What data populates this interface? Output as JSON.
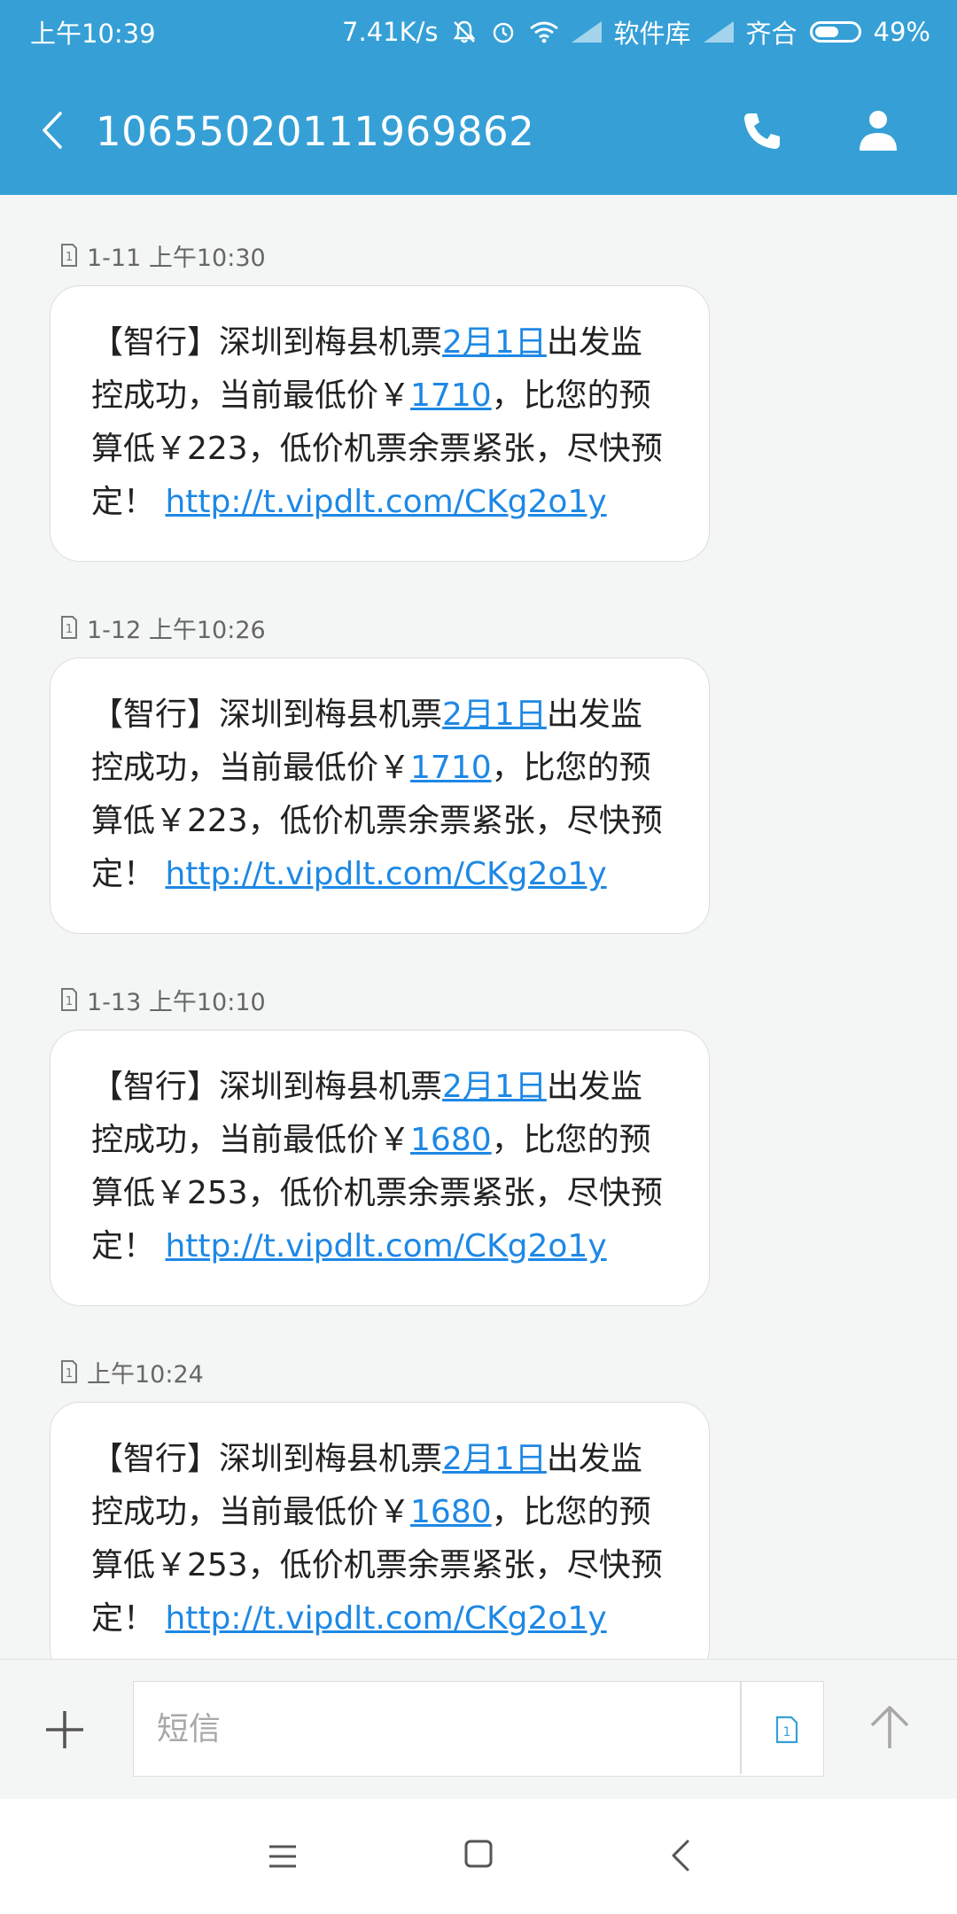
{
  "status_bar": {
    "time": "上午10:39",
    "net_speed": "7.41K/s",
    "carrier1": "软件库",
    "carrier2": "齐合",
    "battery": "49%"
  },
  "header": {
    "contact_number": "10655020111969862",
    "icons": [
      "back-arrow-icon",
      "phone-icon",
      "person-icon"
    ]
  },
  "messages": [
    {
      "sim": "1",
      "time": "1-11 上午10:30",
      "text": {
        "p1": "【智行】深圳到梅县机票",
        "date_link": "2月1日",
        "p2": "出发监控成功，当前最低价￥",
        "price_link": "1710",
        "p3": "，比您的预算低￥223，低价机票余票紧张，尽快预定！ ",
        "url": "http://t.vipdlt.com/CKg2o1y"
      }
    },
    {
      "sim": "1",
      "time": "1-12 上午10:26",
      "text": {
        "p1": "【智行】深圳到梅县机票",
        "date_link": "2月1日",
        "p2": "出发监控成功，当前最低价￥",
        "price_link": "1710",
        "p3": "，比您的预算低￥223，低价机票余票紧张，尽快预定！ ",
        "url": "http://t.vipdlt.com/CKg2o1y"
      }
    },
    {
      "sim": "1",
      "time": "1-13 上午10:10",
      "text": {
        "p1": "【智行】深圳到梅县机票",
        "date_link": "2月1日",
        "p2": "出发监控成功，当前最低价￥",
        "price_link": "1680",
        "p3": "，比您的预算低￥253，低价机票余票紧张，尽快预定！ ",
        "url": "http://t.vipdlt.com/CKg2o1y"
      }
    },
    {
      "sim": "1",
      "time": "上午10:24",
      "text": {
        "p1": "【智行】深圳到梅县机票",
        "date_link": "2月1日",
        "p2": "出发监控成功，当前最低价￥",
        "price_link": "1680",
        "p3": "，比您的预算低￥253，低价机票余票紧张，尽快预定！ ",
        "url": "http://t.vipdlt.com/CKg2o1y"
      }
    }
  ],
  "composer": {
    "placeholder": "短信",
    "sim_label": "1",
    "icons": [
      "plus-icon",
      "sim-select-icon",
      "send-arrow-icon"
    ]
  },
  "nav": {
    "icons": [
      "menu-icon",
      "home-icon",
      "back-icon"
    ]
  },
  "colors": {
    "header": "#36a0d6",
    "link": "#1e88e5",
    "background": "#f4f6f5"
  }
}
